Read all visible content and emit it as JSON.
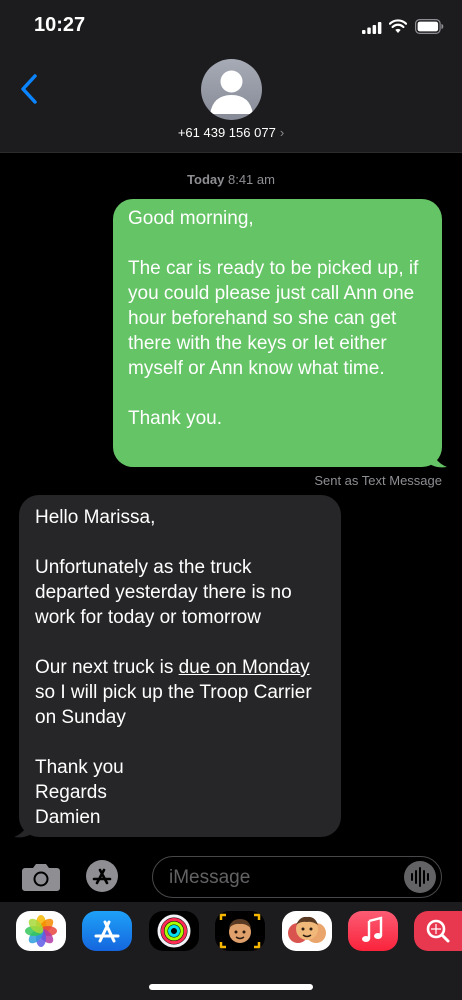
{
  "status_bar": {
    "time": "10:27"
  },
  "header": {
    "contact": "+61 439 156 077",
    "chevron": "›"
  },
  "conversation": {
    "timestamp_day": "Today",
    "timestamp_time": "8:41 am",
    "sent_message": "Good morning,\n\nThe car is ready to be picked up, if you could please just call Ann one hour beforehand so she can get there with the keys or let either myself or Ann know what time.\n\nThank you.",
    "sent_note": "Sent as Text Message",
    "received_message": {
      "part1": "Hello Marissa,\n\nUnfortunately as the truck departed yesterday there is no work for today or tomorrow\n\nOur next truck is ",
      "link": "due on Monday",
      "part2": " so I will pick up the Troop Carrier on Sunday\n\nThank you\nRegards\nDamien"
    }
  },
  "input_bar": {
    "placeholder": "iMessage"
  },
  "app_drawer": {
    "apps": [
      "photos-icon",
      "app-store-icon",
      "activity-icon",
      "memoji-icon",
      "animoji-icon",
      "music-icon",
      "search-images-icon"
    ]
  },
  "colors": {
    "sent_bubble": "#65c466",
    "received_bubble": "#262628",
    "accent": "#0a84ff"
  }
}
